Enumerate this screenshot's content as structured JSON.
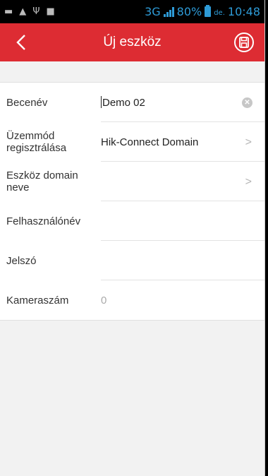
{
  "status_bar": {
    "network": "3G",
    "battery": "80%",
    "time_prefix": "de.",
    "time": "10:48"
  },
  "header": {
    "title": "Új eszköz"
  },
  "form": {
    "rows": [
      {
        "label": "Becenév",
        "value": "Demo 02"
      },
      {
        "label": "Üzemmód regisztrálása",
        "value": "Hik-Connect Domain"
      },
      {
        "label": "Eszköz domain neve",
        "value": ""
      },
      {
        "label": "Felhasználónév",
        "value": ""
      },
      {
        "label": "Jelszó",
        "value": ""
      },
      {
        "label": "Kameraszám",
        "value": "0"
      }
    ]
  },
  "colors": {
    "header_bg": "#dd2c33",
    "page_bg": "#f2f2f2",
    "status_accent": "#2e9bd7"
  },
  "icons": [
    "back-arrow-icon",
    "save-icon",
    "clear-icon",
    "chevron-right-icon"
  ]
}
